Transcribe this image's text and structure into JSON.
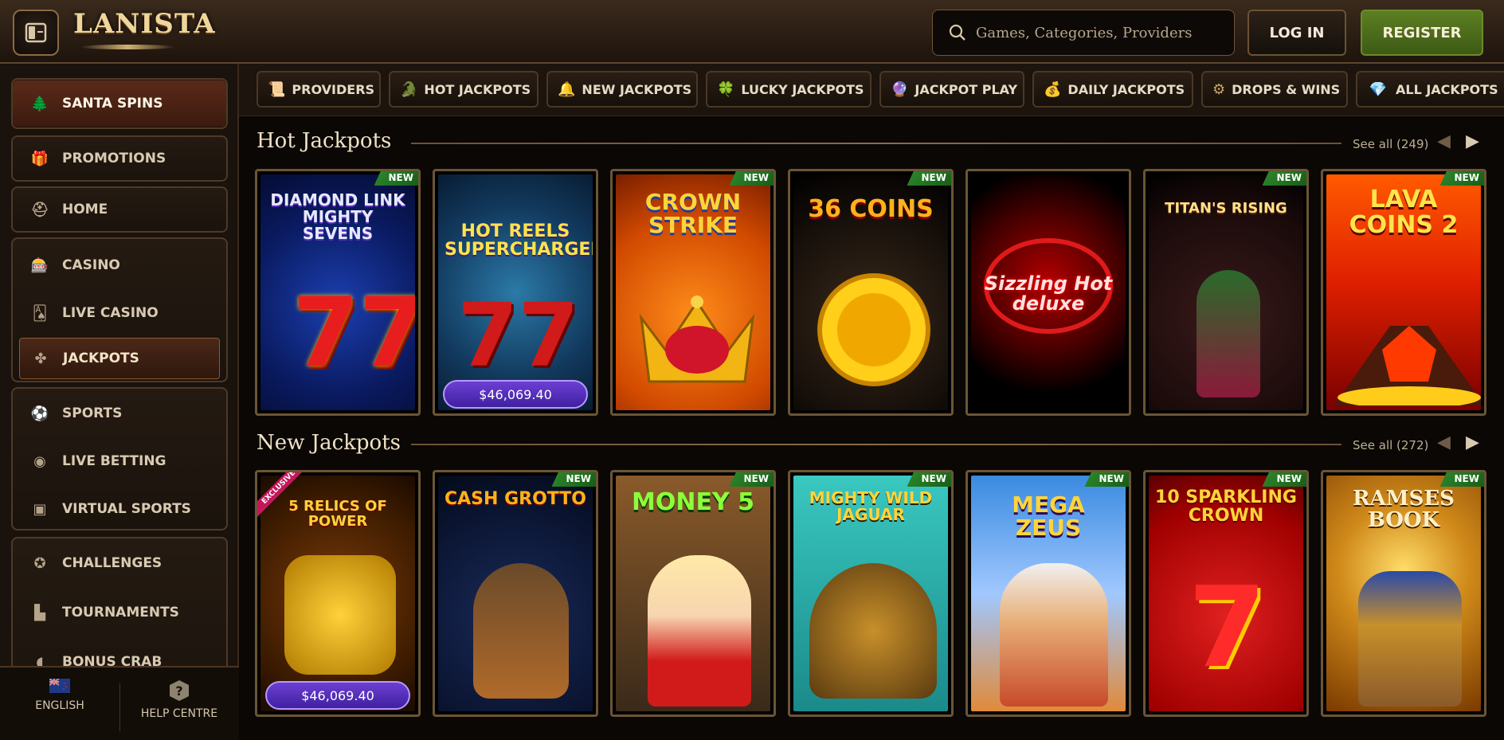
{
  "header": {
    "logo": "LANISTA",
    "search_placeholder": "Games, Categories, Providers",
    "login_label": "LOG IN",
    "register_label": "REGISTER"
  },
  "sidebar": {
    "items": [
      {
        "label": "SANTA SPINS",
        "icon": "tree-icon"
      },
      {
        "label": "PROMOTIONS",
        "icon": "gift-icon"
      },
      {
        "label": "HOME",
        "icon": "helmet-icon"
      },
      {
        "label": "CASINO",
        "icon": "slot-icon"
      },
      {
        "label": "LIVE CASINO",
        "icon": "cards-icon"
      },
      {
        "label": "JACKPOTS",
        "icon": "clover-icon"
      },
      {
        "label": "SPORTS",
        "icon": "ball-icon"
      },
      {
        "label": "LIVE BETTING",
        "icon": "live-icon"
      },
      {
        "label": "VIRTUAL SPORTS",
        "icon": "virtual-icon"
      },
      {
        "label": "CHALLENGES",
        "icon": "medal-icon"
      },
      {
        "label": "TOURNAMENTS",
        "icon": "podium-icon"
      },
      {
        "label": "BONUS CRAB",
        "icon": "crab-icon"
      }
    ],
    "language_label": "ENGLISH",
    "help_label": "HELP CENTRE"
  },
  "tabs": [
    {
      "label": "PROVIDERS"
    },
    {
      "label": "HOT JACKPOTS"
    },
    {
      "label": "NEW JACKPOTS"
    },
    {
      "label": "LUCKY JACKPOTS"
    },
    {
      "label": "JACKPOT PLAY"
    },
    {
      "label": "DAILY JACKPOTS"
    },
    {
      "label": "DROPS & WINS"
    },
    {
      "label": "ALL JACKPOTS"
    }
  ],
  "hot": {
    "title": "Hot Jackpots",
    "see_all": "See all (249)",
    "games": [
      {
        "title": "DIAMOND LINK MIGHTY SEVENS",
        "badge": "NEW",
        "jackpot": ""
      },
      {
        "title": "HOT REELS SUPERCHARGED",
        "badge": "",
        "jackpot": "$46,069.40"
      },
      {
        "title": "CROWN STRIKE",
        "badge": "NEW",
        "jackpot": ""
      },
      {
        "title": "36 COINS",
        "badge": "NEW",
        "jackpot": ""
      },
      {
        "title": "Sizzling Hot deluxe",
        "badge": "",
        "jackpot": ""
      },
      {
        "title": "TITAN'S RISING",
        "badge": "NEW",
        "jackpot": ""
      },
      {
        "title": "LAVA COINS 2",
        "badge": "NEW",
        "jackpot": ""
      }
    ]
  },
  "new": {
    "title": "New Jackpots",
    "see_all": "See all (272)",
    "games": [
      {
        "title": "5 RELICS OF POWER",
        "badge": "EXCLUSIVE",
        "jackpot": "$46,069.40"
      },
      {
        "title": "CASH GROTTO",
        "badge": "NEW",
        "jackpot": ""
      },
      {
        "title": "MONEY 5",
        "badge": "NEW",
        "jackpot": ""
      },
      {
        "title": "MIGHTY WILD JAGUAR",
        "badge": "NEW",
        "jackpot": ""
      },
      {
        "title": "MEGA ZEUS",
        "badge": "NEW",
        "jackpot": ""
      },
      {
        "title": "10 SPARKLING CROWN",
        "badge": "NEW",
        "jackpot": ""
      },
      {
        "title": "RAMSES BOOK",
        "badge": "NEW",
        "jackpot": ""
      }
    ]
  },
  "colors": {
    "accent_gold": "#d4b070",
    "register_green": "#5d7f22",
    "new_badge": "#2d8a2d",
    "jackpot_purple": "#5a2fc4"
  }
}
